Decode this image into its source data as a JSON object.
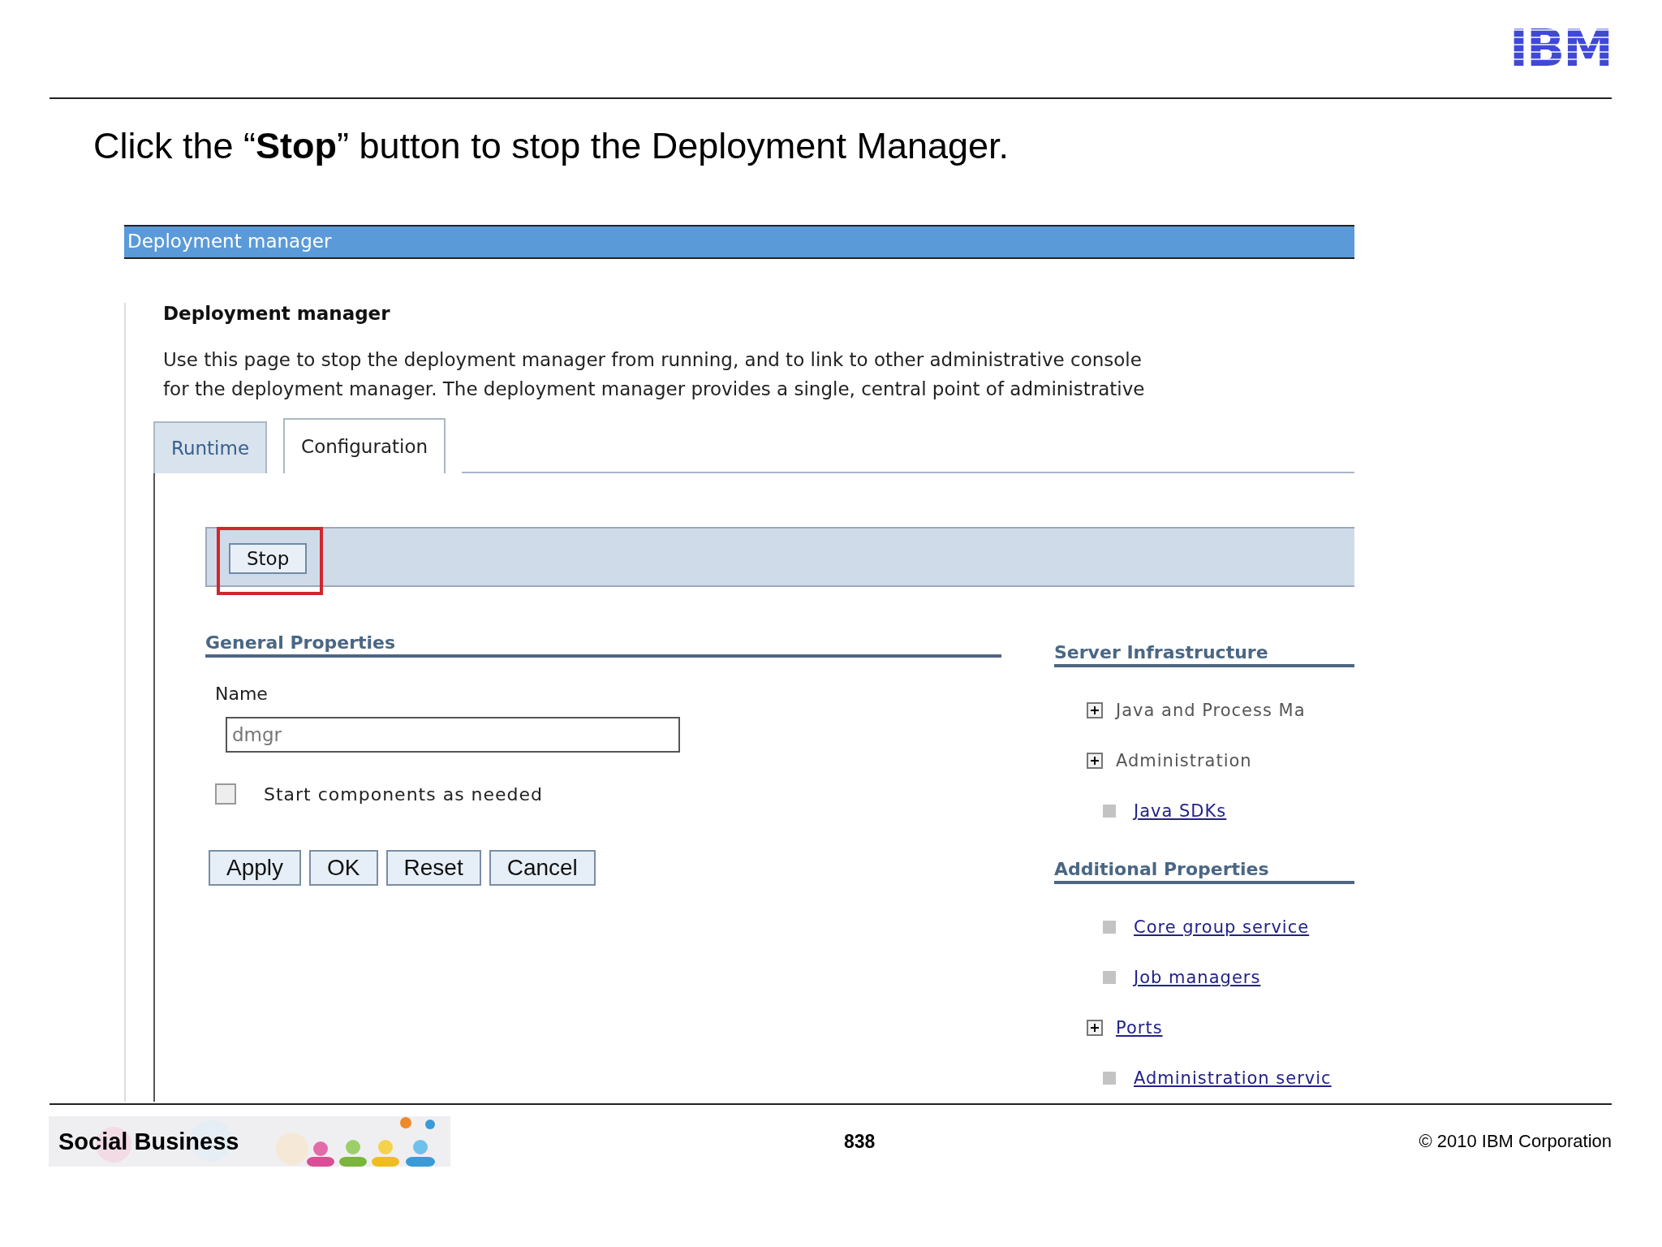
{
  "logo": "IBM",
  "slide_title": "Click the “**Stop**” button to stop the Deployment Manager.",
  "window": {
    "title": "Deployment manager"
  },
  "page": {
    "heading": "Deployment manager",
    "description": [
      "Use this page to stop the deployment manager from running, and to link to other administrative console",
      "for the deployment manager. The deployment manager provides a single, central point of administrative"
    ]
  },
  "tabs": [
    {
      "label": "Runtime",
      "selected": false
    },
    {
      "label": "Configuration",
      "selected": true
    }
  ],
  "toolbar": {
    "button": {
      "label": "Stop",
      "highlighted": true
    }
  },
  "general_properties": {
    "heading": "General Properties",
    "name_label": "Name",
    "name_value": "dmgr",
    "checkbox": {
      "label": "Start components as needed",
      "checked": false
    },
    "buttons": [
      "Apply",
      "OK",
      "Reset",
      "Cancel"
    ]
  },
  "sections": [
    {
      "heading": "Server Infrastructure",
      "items": [
        {
          "label": "Java and Process Ma",
          "expandable": true,
          "link": false
        },
        {
          "label": "Administration",
          "expandable": true,
          "link": false
        },
        {
          "label": "Java SDKs",
          "expandable": false,
          "link": true
        }
      ]
    },
    {
      "heading": "Additional Properties",
      "items": [
        {
          "label": "Core group service",
          "expandable": false,
          "link": true
        },
        {
          "label": "Job managers",
          "expandable": false,
          "link": true
        },
        {
          "label": "Ports",
          "expandable": true,
          "link": true
        },
        {
          "label": "Administration servic",
          "expandable": false,
          "link": true
        }
      ]
    }
  ],
  "footer": {
    "banner": "Social Business",
    "page_number": "838",
    "copyright": "© 2010 IBM Corporation"
  }
}
